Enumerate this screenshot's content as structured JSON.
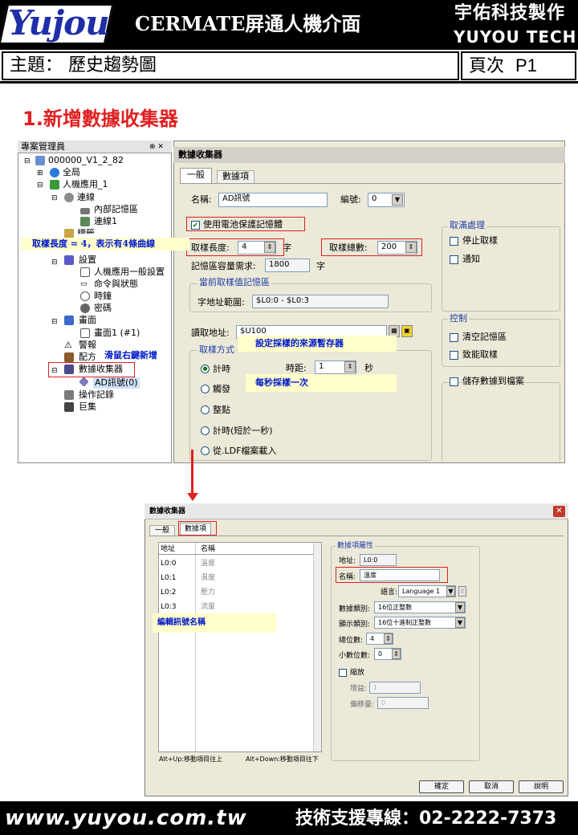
{
  "header": {
    "logo": "Yujou",
    "title": "CERMATE屏通人機介面",
    "company_cn": "宇佑科技製作",
    "company_en": "YUYOU TECH"
  },
  "subject": {
    "label": "主題：",
    "title": "歷史趨勢圖",
    "page_label": "頁次",
    "page": "P1"
  },
  "section_title": "1.新增數據收集器",
  "tree": {
    "title": "專案管理員",
    "pin": "⊕ ✕",
    "items": [
      "000000_V1_2_82",
      "全局",
      "人機應用_1",
      "連線",
      "內部記憶區",
      "連線1",
      "設置",
      "人機應用一般設置",
      "命令與狀態",
      "時鐘",
      "密碼",
      "畫面",
      "畫面1 (#1)",
      "警報",
      "配方",
      "數據收集器",
      "AD訊號(0)",
      "操作記錄",
      "巨集"
    ],
    "partial": "標籤"
  },
  "win1": {
    "title": "數據收集器",
    "tabs": [
      "一般",
      "數據項"
    ],
    "name_label": "名稱:",
    "name_value": "AD訊號",
    "num_label": "編號:",
    "num_value": "0",
    "battery": "使用電池保護記憶體",
    "sample_len_label": "取樣長度:",
    "sample_len": "4",
    "unit_char": "字",
    "sample_total_label": "取樣總數:",
    "sample_total": "200",
    "mem_label": "記憶區容量需求:",
    "mem_value": "1800",
    "current_group": "當前取樣值記憶區",
    "range_label": "字地址範圍:",
    "range_value": "$L0:0 - $L0:3",
    "read_label": "讀取地址:",
    "read_value": "$U100",
    "method_group": "取樣方式",
    "methods": [
      "計時",
      "觸發",
      "整點",
      "計時(短於一秒)",
      "從.LDF檔案載入"
    ],
    "interval_label": "時距:",
    "interval_value": "1",
    "sec": "秒",
    "full_group": "取滿處理",
    "full_opts": [
      "停止取樣",
      "通知"
    ],
    "ctrl_group": "控制",
    "ctrl_opts": [
      "清空記憶區",
      "致能取樣"
    ],
    "save_file": "儲存數據到檔案"
  },
  "annotations": {
    "sample_len": "取樣長度 = 4，表示有4條曲線",
    "right_click": "滑鼠右鍵新增",
    "source": "設定採樣的來源暫存器",
    "per_sec": "每秒採樣一次",
    "edit_name": "編輯訊號名稱"
  },
  "dialog": {
    "title": "數據收集器",
    "close": "✕",
    "tabs": [
      "一般",
      "數據項"
    ],
    "table_headers": [
      "地址",
      "名稱"
    ],
    "rows": [
      [
        "L0:0",
        "溫度"
      ],
      [
        "L0:1",
        "濕度"
      ],
      [
        "L0:2",
        "壓力"
      ],
      [
        "L0:3",
        "流量"
      ]
    ],
    "hint1": "Alt+Up:移動項目往上",
    "hint2": "Alt+Down:移動項目往下",
    "prop_group": "數據項屬性",
    "addr_label": "地址:",
    "addr_value": "L0:0",
    "name_label": "名稱:",
    "name_value": "溫度",
    "lang_label": "語言:",
    "lang_value": "Language 1",
    "dtype_label": "數據類別:",
    "dtype_value": "16位正整數",
    "disp_label": "顯示類別:",
    "disp_value": "16位十進制正整數",
    "total_label": "總位數:",
    "total_value": "4",
    "dec_label": "小數位數:",
    "dec_value": "0",
    "scale": "縮放",
    "gain_label": "增益:",
    "gain_value": "1",
    "offset_label": "偏移量:",
    "offset_value": "0",
    "buttons": [
      "確定",
      "取消",
      "說明"
    ]
  },
  "footer": {
    "url": "www.yuyou.com.tw",
    "hotline": "技術支援專線：02-2222-7373"
  }
}
